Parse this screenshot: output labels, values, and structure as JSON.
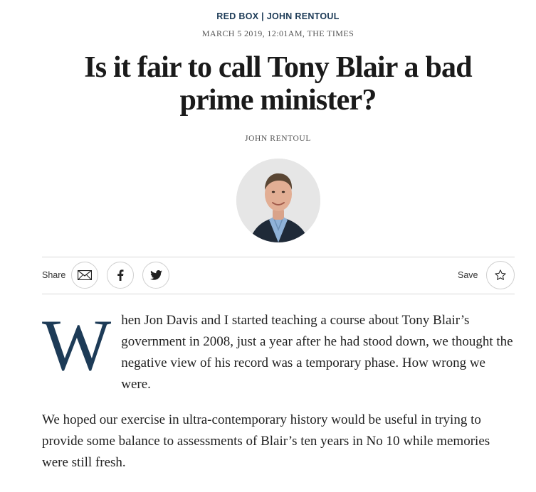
{
  "kicker": "RED BOX | JOHN RENTOUL",
  "dateline": "MARCH 5 2019, 12:01AM, THE TIMES",
  "headline": "Is it fair to call Tony Blair a bad prime minister?",
  "byline": "JOHN RENTOUL",
  "share_bar": {
    "share_label": "Share",
    "buttons": [
      {
        "icon": "email-icon"
      },
      {
        "icon": "facebook-icon"
      },
      {
        "icon": "twitter-icon"
      }
    ],
    "save_label": "Save",
    "save_icon": "star-icon"
  },
  "article": {
    "dropcap": "W",
    "para1": "hen Jon Davis and I started teaching a course about Tony Blair’s government in 2008, just a year after he had stood down, we thought the negative view of his record was a temporary phase. How wrong we were.",
    "para2": "We hoped our exercise in ultra-contemporary history would be useful in trying to provide some balance to assessments of Blair’s ten years in No 10 while memories were still fresh."
  },
  "colors": {
    "accent": "#1d3b57",
    "text": "#222222",
    "divider": "#d8d8d8"
  }
}
